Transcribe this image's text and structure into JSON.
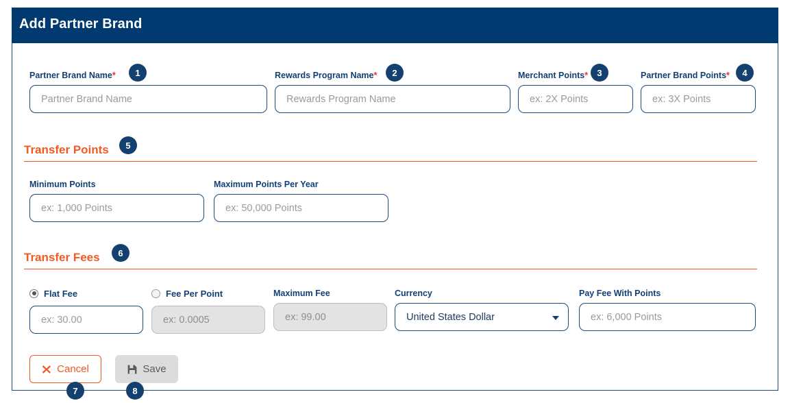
{
  "header": {
    "title": "Add Partner Brand",
    "bg_color": "#003a70",
    "text_color": "#ffffff"
  },
  "theme": {
    "navy": "#003a70",
    "label_navy": "#123f76",
    "orange": "#f15a22",
    "cancel_orange": "#ee5a24",
    "required_red": "#e8312b",
    "badge_navy": "#14406f",
    "disabled_gray": "#e3e3e3"
  },
  "form": {
    "row1": [
      {
        "label": "Partner Brand Name",
        "required": "*",
        "placeholder": "Partner Brand Name",
        "value": "",
        "disabled": false
      },
      {
        "label": "Rewards Program Name",
        "required": "*",
        "placeholder": "Rewards Program Name",
        "value": "",
        "disabled": false
      },
      {
        "label": "Merchant Points",
        "required": "*",
        "placeholder": "ex: 2X Points",
        "value": "",
        "disabled": false
      },
      {
        "label": "Partner Brand Points",
        "required": "*",
        "placeholder": "ex: 3X Points",
        "value": "",
        "disabled": false
      }
    ],
    "transfer_points": {
      "title": "Transfer Points",
      "fields": [
        {
          "label": "Minimum Points",
          "placeholder": "ex: 1,000 Points",
          "value": "",
          "disabled": false
        },
        {
          "label": "Maximum Points Per Year",
          "placeholder": "ex: 50,000 Points",
          "value": "",
          "disabled": false
        }
      ]
    },
    "transfer_fees": {
      "title": "Transfer Fees",
      "flat_fee": {
        "label": "Flat Fee",
        "selected": true,
        "placeholder": "ex: 30.00",
        "value": "",
        "disabled": false
      },
      "fee_per_point": {
        "label": "Fee Per Point",
        "selected": false,
        "placeholder": "ex: 0.0005",
        "value": "",
        "disabled": true
      },
      "maximum_fee": {
        "label": "Maximum Fee",
        "placeholder": "ex: 99.00",
        "value": "",
        "disabled": true
      },
      "currency": {
        "label": "Currency",
        "selected_option": "United States Dollar",
        "options": [
          "United States Dollar"
        ]
      },
      "pay_fee_with_points": {
        "label": "Pay Fee With Points",
        "placeholder": "ex: 6,000 Points",
        "value": "",
        "disabled": false
      }
    }
  },
  "actions": {
    "cancel": {
      "label": "Cancel",
      "icon": "close-x-icon"
    },
    "save": {
      "label": "Save",
      "icon": "floppy-disk-icon",
      "disabled": true
    }
  },
  "annotations": [
    {
      "number": "1"
    },
    {
      "number": "2"
    },
    {
      "number": "3"
    },
    {
      "number": "4"
    },
    {
      "number": "5"
    },
    {
      "number": "6"
    },
    {
      "number": "7"
    },
    {
      "number": "8"
    }
  ]
}
